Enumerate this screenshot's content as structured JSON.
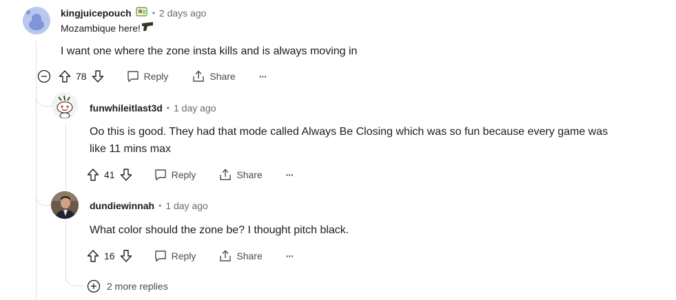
{
  "comments": [
    {
      "username": "kingjuicepouch",
      "time": "2 days ago",
      "flair": "Mozambique here!",
      "body": "I want one where the zone insta kills and is always moving in",
      "score": "78",
      "reply_label": "Reply",
      "share_label": "Share",
      "more_label": "···"
    },
    {
      "username": "funwhileitlast3d",
      "time": "1 day ago",
      "body_line1": "Oo this is good. They had that mode called Always Be Closing which was so fun because every game was",
      "body_line2": "like 11 mins max",
      "score": "41",
      "reply_label": "Reply",
      "share_label": "Share",
      "more_label": "···"
    },
    {
      "username": "dundiewinnah",
      "time": "1 day ago",
      "body": "What color should the zone be? I thought pitch black.",
      "score": "16",
      "reply_label": "Reply",
      "share_label": "Share",
      "more_label": "···"
    }
  ],
  "more_replies": "2 more replies",
  "separator": "•",
  "icons": [
    "reddit-avatar-icon",
    "flair-badge-icon",
    "gun-emoji-icon",
    "collapse-icon",
    "upvote-icon",
    "downvote-icon",
    "reply-icon",
    "share-icon",
    "more-options-icon",
    "expand-replies-icon"
  ]
}
